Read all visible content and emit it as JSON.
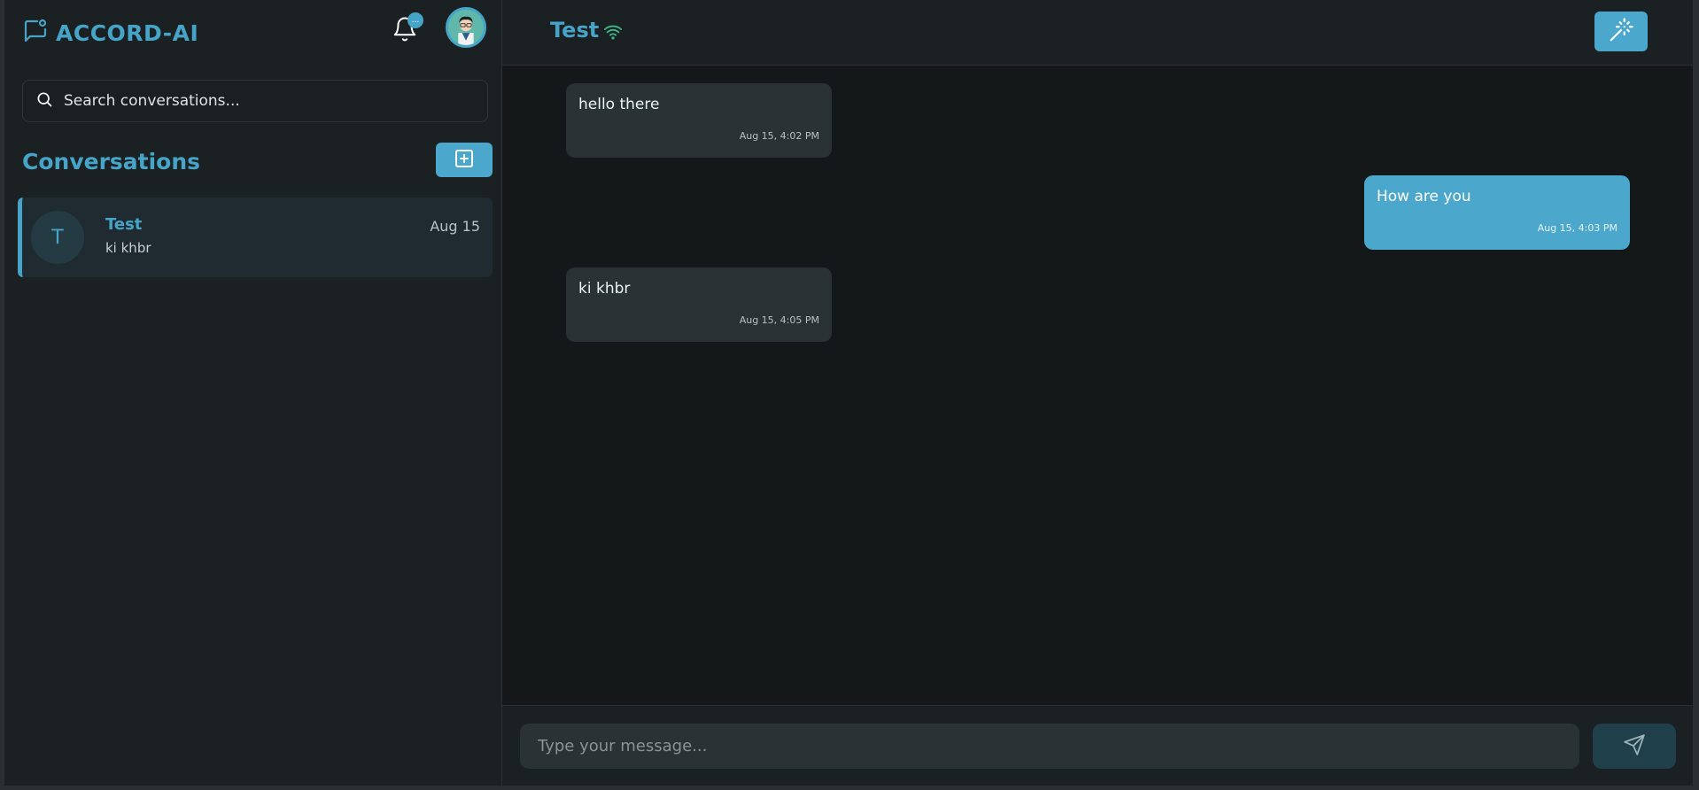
{
  "sidebar": {
    "brand_name": "ACCORD-AI",
    "notification_badge": "...",
    "search_placeholder": "Search conversations...",
    "conversations_heading": "Conversations",
    "conversations": [
      {
        "initial": "T",
        "name": "Test",
        "date": "Aug 15",
        "preview": "ki khbr"
      }
    ]
  },
  "chat": {
    "title": "Test",
    "messages": [
      {
        "direction": "incoming",
        "text": "hello there",
        "time": "Aug 15, 4:02 PM"
      },
      {
        "direction": "outgoing",
        "text": "How are you",
        "time": "Aug 15, 4:03 PM"
      },
      {
        "direction": "incoming",
        "text": "ki khbr",
        "time": "Aug 15, 4:05 PM"
      }
    ],
    "input_placeholder": "Type your message..."
  },
  "icons": {
    "brand": "message-square-icon",
    "bell": "bell-icon",
    "search": "search-icon",
    "new_conversation": "plus-square-icon",
    "status": "wifi-icon",
    "magic": "magic-wand-icon",
    "send": "send-icon"
  },
  "colors": {
    "accent": "#46a4c8",
    "accent_button": "#4ca7cc",
    "background": "#151819",
    "panel": "#1b2022",
    "incoming_bubble": "#2a3234",
    "selected_conversation": "#1f2b30"
  }
}
